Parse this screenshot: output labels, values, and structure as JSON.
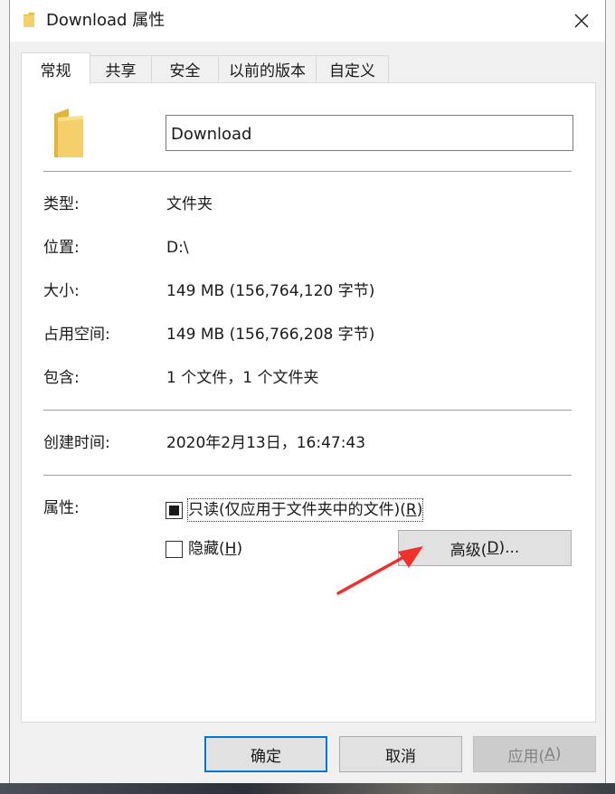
{
  "window": {
    "title": "Download 属性",
    "close_icon": "close-icon"
  },
  "tabs": [
    {
      "label": "常规",
      "active": true
    },
    {
      "label": "共享",
      "active": false
    },
    {
      "label": "安全",
      "active": false
    },
    {
      "label": "以前的版本",
      "active": false
    },
    {
      "label": "自定义",
      "active": false
    }
  ],
  "general": {
    "folder_icon": "folder-icon",
    "name_value": "Download",
    "rows": {
      "type": {
        "label": "类型:",
        "value": "文件夹"
      },
      "location": {
        "label": "位置:",
        "value": "D:\\"
      },
      "size": {
        "label": "大小:",
        "value": "149 MB (156,764,120 字节)"
      },
      "disk": {
        "label": "占用空间:",
        "value": "149 MB (156,766,208 字节)"
      },
      "contains": {
        "label": "包含:",
        "value": "1 个文件，1 个文件夹"
      },
      "created": {
        "label": "创建时间:",
        "value": "2020年2月13日，16:47:43"
      }
    },
    "attributes": {
      "label": "属性:",
      "readonly_text": "只读(仅应用于文件夹中的文件)(",
      "readonly_key": "R",
      "readonly_state": "indeterminate",
      "hidden_text": "隐藏(",
      "hidden_key": "H",
      "hidden_checked": false,
      "advanced_text": "高级(",
      "advanced_key": "D",
      "advanced_suffix": ")..."
    }
  },
  "footer": {
    "ok_label": "确定",
    "cancel_label": "取消",
    "apply_text": "应用(",
    "apply_key": "A",
    "apply_enabled": false
  },
  "colors": {
    "annotation_arrow": "#f0312b",
    "folder": "#f5d06a",
    "focus": "#0078d7"
  }
}
